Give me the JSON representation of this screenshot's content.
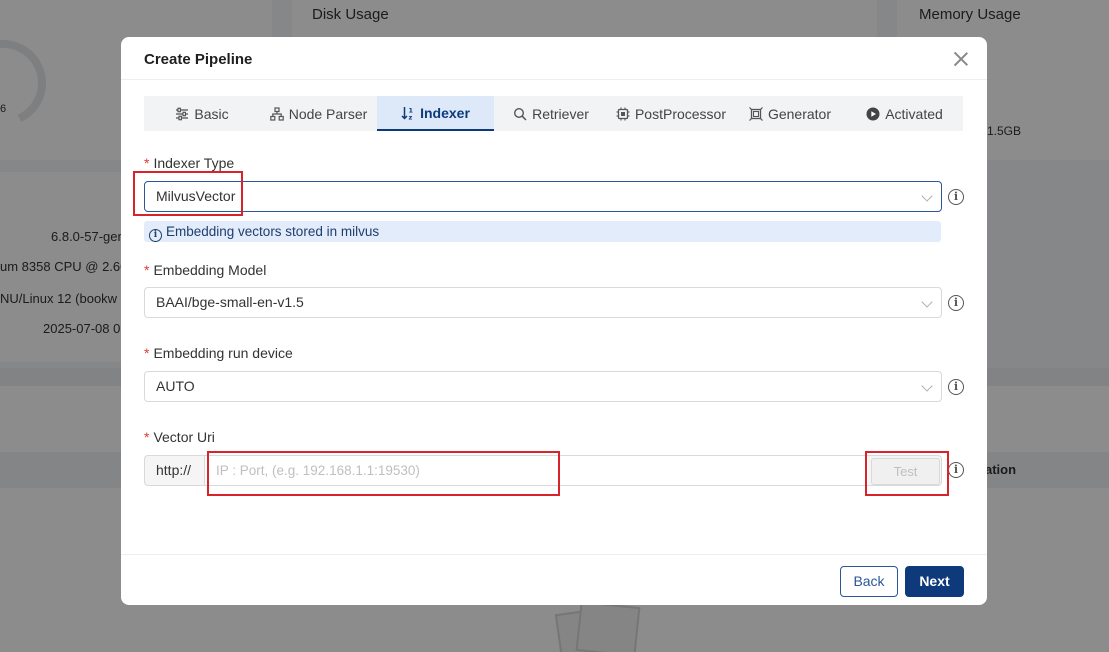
{
  "background": {
    "disk_usage_title": "Disk Usage",
    "memory_usage_title": "Memory Usage",
    "gauge_pct_fragment": "6",
    "memory_value_fragment": "1.5GB",
    "info_rows": [
      "6.8.0-57-ger",
      "um 8358 CPU @ 2.60",
      "NU/Linux 12 (bookw",
      "2025-07-08 0"
    ],
    "table_header_fragment": "ation"
  },
  "modal": {
    "title": "Create Pipeline",
    "tabs": [
      {
        "label": "Basic",
        "icon": "sliders-icon"
      },
      {
        "label": "Node Parser",
        "icon": "hierarchy-icon"
      },
      {
        "label": "Indexer",
        "icon": "sort-icon"
      },
      {
        "label": "Retriever",
        "icon": "search-icon"
      },
      {
        "label": "PostProcessor",
        "icon": "chip-icon"
      },
      {
        "label": "Generator",
        "icon": "frame-icon"
      },
      {
        "label": "Activated",
        "icon": "play-circle-icon"
      }
    ],
    "active_tab": "Indexer",
    "fields": {
      "indexer_type": {
        "label": "Indexer Type",
        "value": "MilvusVector",
        "hint": "Embedding vectors stored in milvus"
      },
      "embedding_model": {
        "label": "Embedding Model",
        "value": "BAAI/bge-small-en-v1.5"
      },
      "embedding_device": {
        "label": "Embedding run device",
        "value": "AUTO"
      },
      "vector_uri": {
        "label": "Vector Uri",
        "prefix": "http://",
        "value": "",
        "placeholder": "IP : Port, (e.g. 192.168.1.1:19530)",
        "test_label": "Test"
      }
    },
    "footer": {
      "back_label": "Back",
      "next_label": "Next"
    }
  },
  "colors": {
    "primary": "#0e3a7c",
    "required": "#e53935",
    "highlight_box": "#d9232a",
    "hint_bg": "#e2ecfa"
  }
}
